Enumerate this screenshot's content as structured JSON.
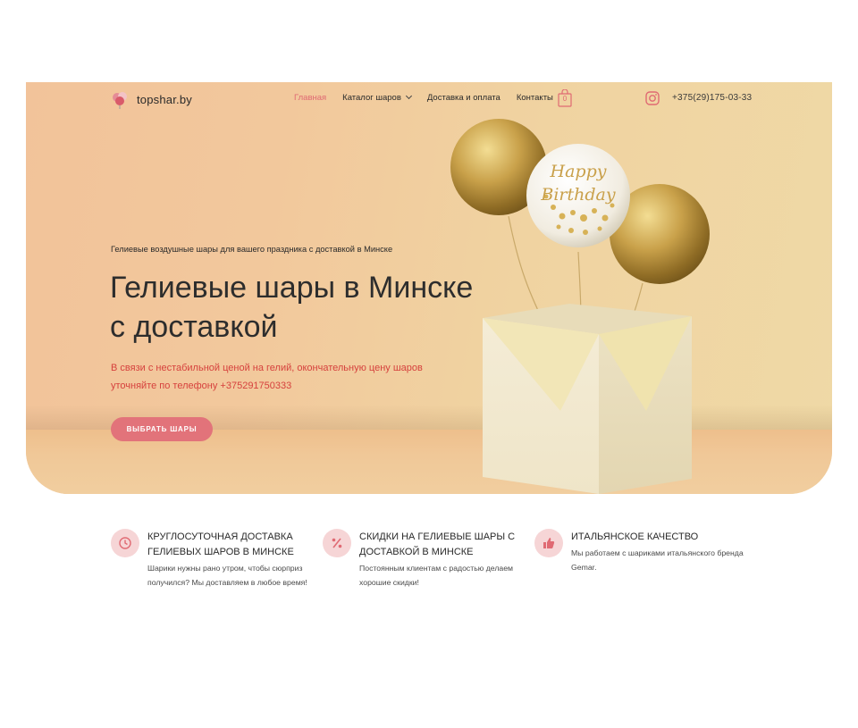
{
  "header": {
    "logo_text": "topshar.by",
    "nav": [
      {
        "label": "Главная",
        "active": true
      },
      {
        "label": "Каталог шаров",
        "has_dropdown": true
      },
      {
        "label": "Доставка и оплата"
      },
      {
        "label": "Контакты"
      }
    ],
    "cart_count": "0",
    "cart_icon": "shopping-bag-icon",
    "instagram_icon": "instagram-icon",
    "phone": "+375(29)175-03-33"
  },
  "hero": {
    "eyebrow": "Гелиевые воздушные шары для вашего праздника с доставкой в Минске",
    "title": "Гелиевые шары в Минске с доставкой",
    "notice": "В связи с нестабильной ценой на гелий, окончательную цену шаров уточняйте  по телефону +375291750333",
    "cta_label": "ВЫБРАТЬ ШАРЫ",
    "balloon_text_line1": "Happy",
    "balloon_text_line2": "Birthday"
  },
  "features": [
    {
      "icon": "clock-icon",
      "title": "КРУГЛОСУТОЧНАЯ ДОСТАВКА ГЕЛИЕВЫХ ШАРОВ В МИНСКЕ",
      "description": "Шарики нужны рано утром, чтобы сюрприз получился? Мы доставляем в любое время!"
    },
    {
      "icon": "percent-icon",
      "title": "СКИДКИ НА ГЕЛИЕВЫЕ ШАРЫ С ДОСТАВКОЙ В МИНСКЕ",
      "description": "Постоянным клиентам с радостью делаем хорошие скидки!"
    },
    {
      "icon": "thumbs-up-icon",
      "title": "ИТАЛЬЯНСКОЕ КАЧЕСТВО",
      "description": "Мы работаем с шариками итальянского бренда Gemar."
    }
  ],
  "colors": {
    "accent": "#e2737a",
    "notice_red": "#d6413d",
    "icon_bg": "#f6d5d6"
  }
}
